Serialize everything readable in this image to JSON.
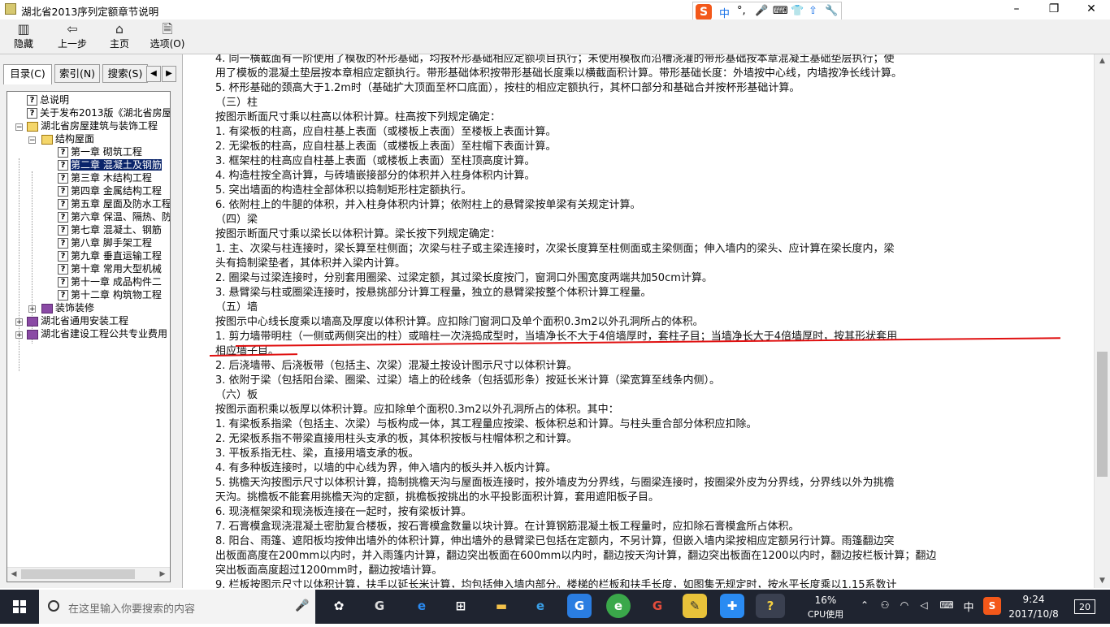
{
  "window": {
    "title": "湖北省2013序列定额章节说明",
    "minimize": "–",
    "maximize": "❐",
    "close": "✕"
  },
  "ime": {
    "items": [
      "S",
      "中",
      "°,",
      "🎤",
      "⌨",
      "👕",
      "⇧",
      "🔧"
    ]
  },
  "toolbar": [
    {
      "label": "隐藏",
      "icon": "hide-icon",
      "glyph": "▥"
    },
    {
      "label": "上一步",
      "icon": "back-arrow-icon",
      "glyph": "⇦"
    },
    {
      "label": "主页",
      "icon": "home-icon",
      "glyph": "⌂"
    },
    {
      "label": "选项(O)",
      "icon": "options-icon",
      "glyph": "🗎"
    }
  ],
  "tabs": [
    {
      "label": "目录(C)"
    },
    {
      "label": "索引(N)"
    },
    {
      "label": "搜索(S)"
    }
  ],
  "tree": [
    {
      "label": "总说明",
      "type": "doc",
      "level": 2
    },
    {
      "label": "关于发布2013版《湖北省房屋",
      "type": "doc",
      "level": 2
    },
    {
      "label": "湖北省房屋建筑与装饰工程",
      "type": "book-open",
      "level": 1,
      "expander": "−"
    },
    {
      "label": "结构屋面",
      "type": "book-open",
      "level": 2,
      "expander": "−"
    },
    {
      "label": "第一章 砌筑工程",
      "type": "doc",
      "level": 3
    },
    {
      "label": "第二章 混凝土及钢筋",
      "type": "doc",
      "level": 3,
      "selected": true
    },
    {
      "label": "第三章 木结构工程",
      "type": "doc",
      "level": 3
    },
    {
      "label": "第四章 金属结构工程",
      "type": "doc",
      "level": 3
    },
    {
      "label": "第五章 屋面及防水工程",
      "type": "doc",
      "level": 3
    },
    {
      "label": "第六章 保温、隔热、防",
      "type": "doc",
      "level": 3
    },
    {
      "label": "第七章 混凝土、钢筋",
      "type": "doc",
      "level": 3
    },
    {
      "label": "第八章 脚手架工程",
      "type": "doc",
      "level": 3
    },
    {
      "label": "第九章 垂直运输工程",
      "type": "doc",
      "level": 3
    },
    {
      "label": "第十章 常用大型机械",
      "type": "doc",
      "level": 3
    },
    {
      "label": "第十一章 成品构件二",
      "type": "doc",
      "level": 3
    },
    {
      "label": "第十二章 构筑物工程",
      "type": "doc",
      "level": 3
    },
    {
      "label": "装饰装修",
      "type": "book",
      "level": 2,
      "expander": "+"
    },
    {
      "label": "湖北省通用安装工程",
      "type": "book",
      "level": 1,
      "expander": "+"
    },
    {
      "label": "湖北省建设工程公共专业费用",
      "type": "book",
      "level": 1,
      "expander": "+"
    }
  ],
  "content": [
    "4. 同一横截面有一阶使用了模板的杯形基础，均按杯形基础相应定额项目执行；未使用模板而沿槽浇灌的带形基础按本章混凝土基础垫层执行；使",
    "用了模板的混凝土垫层按本章相应定额执行。带形基础体积按带形基础长度乘以横截面积计算。带形基础长度：外墙按中心线，内墙按净长线计算。",
    "5. 杯形基础的颈高大于1.2m时（基础扩大顶面至杯口底面），按柱的相应定额执行，其杯口部分和基础合并按杯形基础计算。",
    "（三）柱",
    "按图示断面尺寸乘以柱高以体积计算。柱高按下列规定确定：",
    "1. 有梁板的柱高，应自柱基上表面（或楼板上表面）至楼板上表面计算。",
    "2. 无梁板的柱高，应自柱基上表面（或楼板上表面）至柱帽下表面计算。",
    "3. 框架柱的柱高应自柱基上表面（或楼板上表面）至柱顶高度计算。",
    "4. 构造柱按全高计算，与砖墙嵌接部分的体积并入柱身体积内计算。",
    "5. 突出墙面的构造柱全部体积以捣制矩形柱定额执行。",
    "6. 依附柱上的牛腿的体积，并入柱身体积内计算；依附柱上的悬臂梁按单梁有关规定计算。",
    "（四）梁",
    "按图示断面尺寸乘以梁长以体积计算。梁长按下列规定确定：",
    "1. 主、次梁与柱连接时，梁长算至柱侧面；次梁与柱子或主梁连接时，次梁长度算至柱侧面或主梁侧面；伸入墙内的梁头、应计算在梁长度内，梁",
    "头有捣制梁垫者，其体积并入梁内计算。",
    "2. 圈梁与过梁连接时，分别套用圈梁、过梁定额，其过梁长度按门，窗洞口外围宽度两端共加50cm计算。",
    "3. 悬臂梁与柱或圈梁连接时，按悬挑部分计算工程量，独立的悬臂梁按整个体积计算工程量。",
    "（五）墙",
    "按图示中心线长度乘以墙高及厚度以体积计算。应扣除门窗洞口及单个面积0.3m2以外孔洞所占的体积。",
    "1. 剪力墙带明柱（一侧或两侧突出的柱）或暗柱一次浇捣成型时，当墙净长不大于4倍墙厚时，套柱子目；当墙净长大于4倍墙厚时，按其形状套用",
    "相应墙子目。",
    "2. 后浇墙带、后浇板带（包括主、次梁）混凝土按设计图示尺寸以体积计算。",
    "3. 依附于梁（包括阳台梁、圈梁、过梁）墙上的砼线条（包括弧形条）按延长米计算（梁宽算至线条内侧）。",
    "（六）板",
    "按图示面积乘以板厚以体积计算。应扣除单个面积0.3m2以外孔洞所占的体积。其中：",
    "1. 有梁板系指梁（包括主、次梁）与板构成一体，其工程量应按梁、板体积总和计算。与柱头重合部分体积应扣除。",
    "2. 无梁板系指不带梁直接用柱头支承的板，其体积按板与柱帽体积之和计算。",
    "3. 平板系指无柱、梁，直接用墙支承的板。",
    "4. 有多种板连接时，以墙的中心线为界，伸入墙内的板头并入板内计算。",
    "5. 挑檐天沟按图示尺寸以体积计算，捣制挑檐天沟与屋面板连接时，按外墙皮为分界线，与圈梁连接时，按圈梁外皮为分界线，分界线以外为挑檐",
    "天沟。挑檐板不能套用挑檐天沟的定额，挑檐板按挑出的水平投影面积计算，套用遮阳板子目。",
    "6. 现浇框架梁和现浇板连接在一起时，按有梁板计算。",
    "7. 石膏模盒现浇混凝土密肋复合楼板，按石膏模盒数量以块计算。在计算钢筋混凝土板工程量时，应扣除石膏模盒所占体积。",
    "8. 阳台、雨篷、遮阳板均按伸出墙外的体积计算，伸出墙外的悬臂梁已包括在定额内，不另计算，但嵌入墙内梁按相应定额另行计算。雨篷翻边突",
    "出板面高度在200mm以内时，并入雨篷内计算，翻边突出板面在600mm以内时，翻边按天沟计算，翻边突出板面在1200以内时，翻边按栏板计算；翻边",
    "突出板面高度超过1200mm时，翻边按墙计算。",
    "9. 栏板按图示尺寸以体积计算，扶手以延长米计算，均包括伸入墙内部分。楼梯的栏板和扶手长度，如图集无规定时，按水平长度乘以1.15系数计"
  ],
  "taskbar": {
    "search_placeholder": "在这里输入你要搜索的内容",
    "apps": [
      "task-view-icon",
      "edge-icon",
      "store-icon",
      "explorer-icon",
      "ie-icon",
      "browser-g-icon",
      "360-icon",
      "chrome-icon",
      "sticky-icon",
      "plus-app-icon",
      "help-icon"
    ],
    "cpu_value": "16%",
    "cpu_label": "CPU使用",
    "lang": "中",
    "time": "9:24",
    "date": "2017/10/8",
    "notifications": "20"
  },
  "colors": {
    "annotation": "#e01010",
    "taskbar": "#1f2430",
    "selection": "#0a246a"
  }
}
